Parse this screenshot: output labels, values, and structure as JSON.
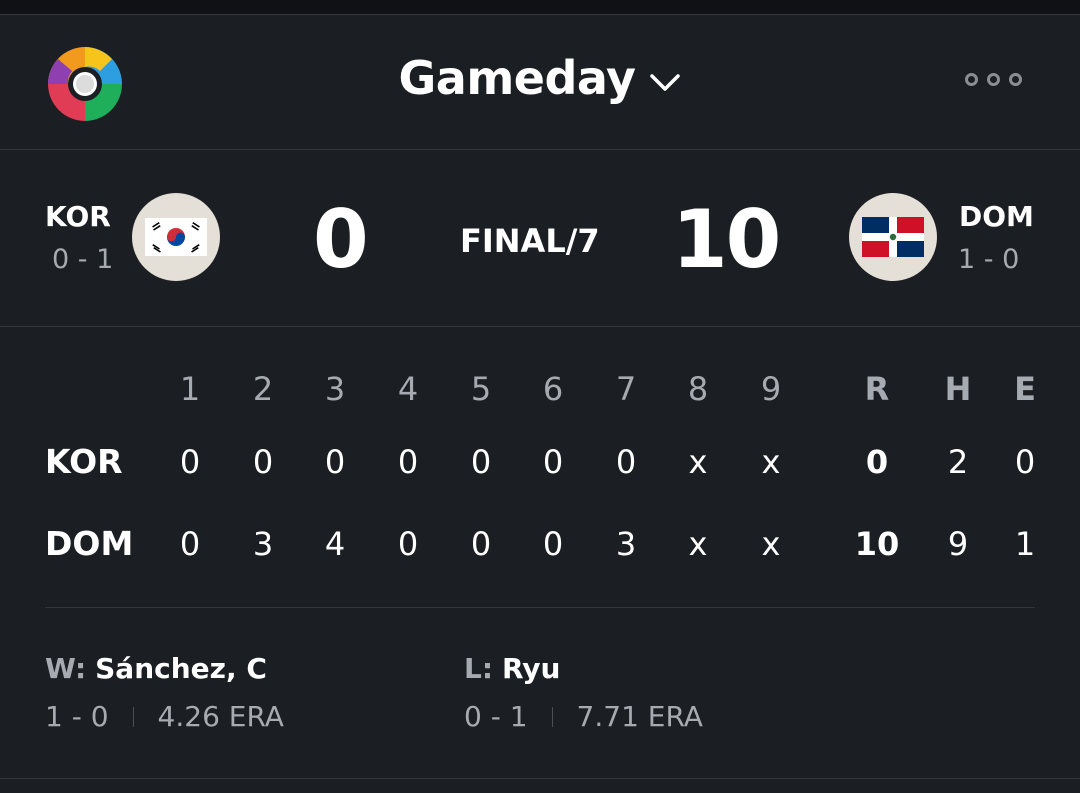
{
  "header": {
    "title": "Gameday",
    "logo_icon": "world-baseball-classic-logo",
    "more_icon": "more-options-icon"
  },
  "game": {
    "status": "FINAL/7",
    "away": {
      "code": "KOR",
      "record": "0 - 1",
      "score": "0",
      "flag_icon": "south-korea-flag"
    },
    "home": {
      "code": "DOM",
      "record": "1 - 0",
      "score": "10",
      "flag_icon": "dominican-republic-flag"
    }
  },
  "linescore": {
    "innings": [
      "1",
      "2",
      "3",
      "4",
      "5",
      "6",
      "7",
      "8",
      "9"
    ],
    "rhe_headers": [
      "R",
      "H",
      "E"
    ],
    "rows": [
      {
        "team": "KOR",
        "innings": [
          "0",
          "0",
          "0",
          "0",
          "0",
          "0",
          "0",
          "x",
          "x"
        ],
        "r": "0",
        "h": "2",
        "e": "0"
      },
      {
        "team": "DOM",
        "innings": [
          "0",
          "3",
          "4",
          "0",
          "0",
          "0",
          "3",
          "x",
          "x"
        ],
        "r": "10",
        "h": "9",
        "e": "1"
      }
    ]
  },
  "pitchers": {
    "win": {
      "label": "W:",
      "name": "Sánchez, C",
      "record": "1 - 0",
      "era": "4.26 ERA"
    },
    "loss": {
      "label": "L:",
      "name": "Ryu",
      "record": "0 - 1",
      "era": "7.71 ERA"
    }
  },
  "colors": {
    "background": "#1b1e22",
    "text": "#ffffff",
    "muted": "#a6abb1",
    "flag_bg": "#e4dfd7"
  }
}
